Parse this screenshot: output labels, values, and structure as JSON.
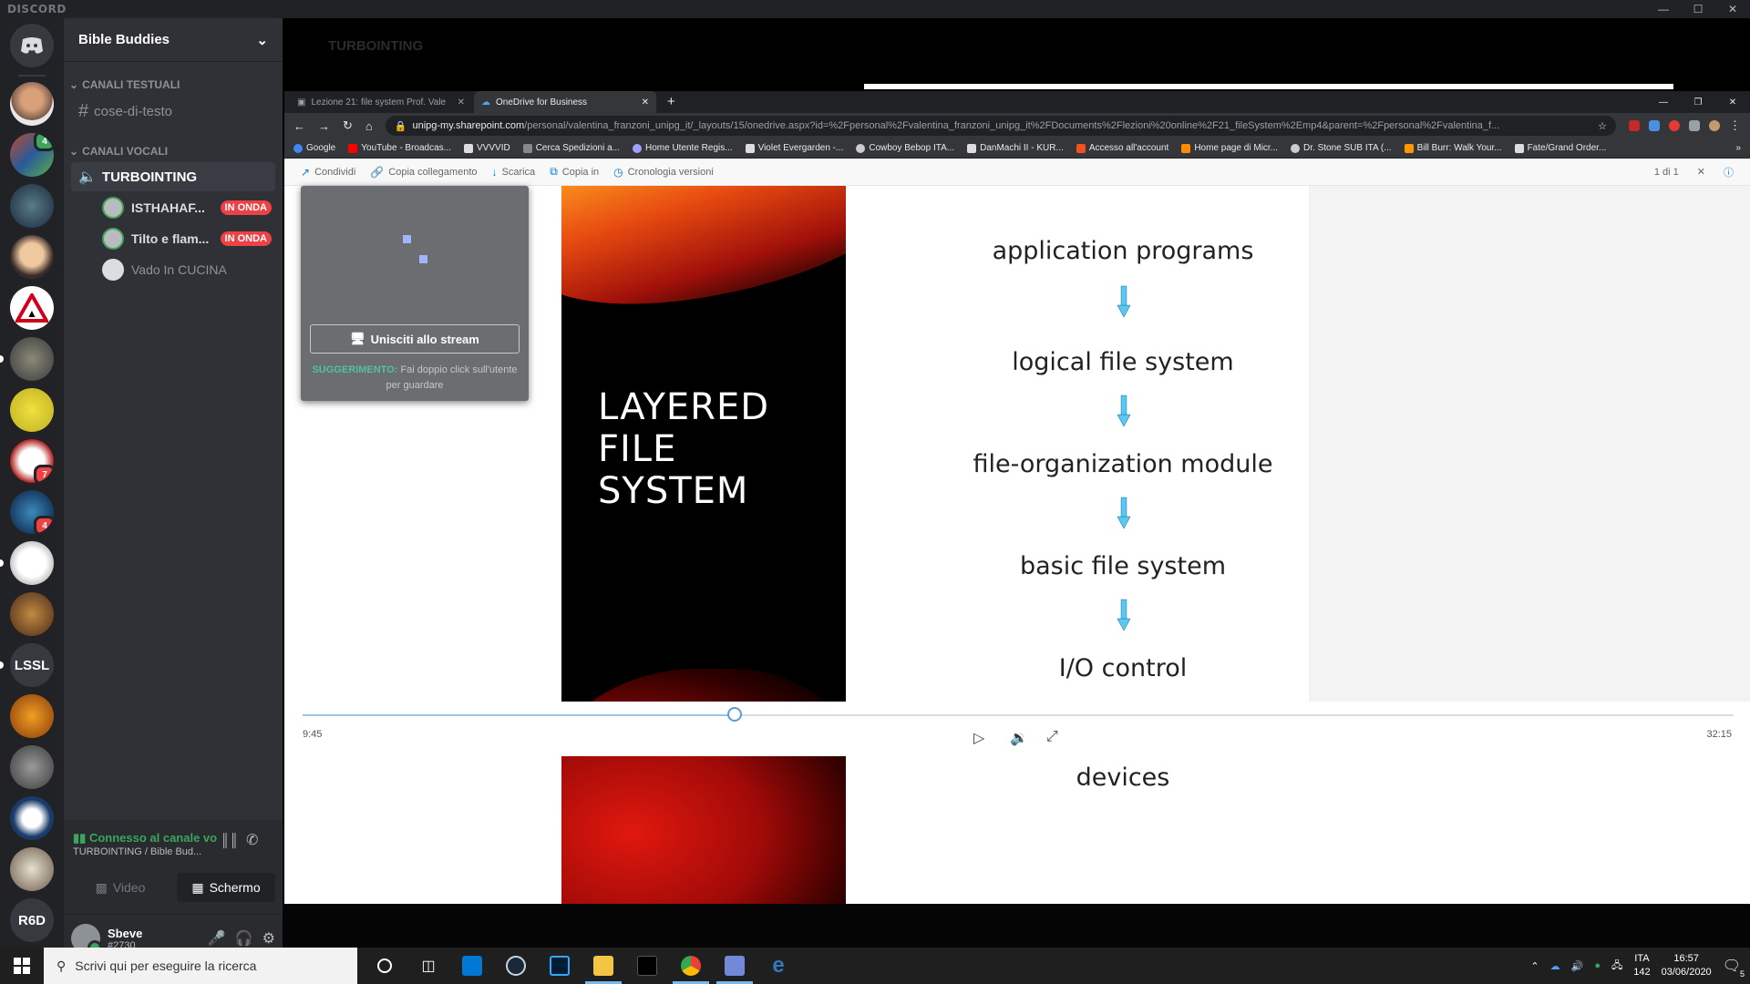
{
  "app": {
    "name": "DISCORD"
  },
  "colors": {
    "accent_green": "#3ba55d",
    "live_red": "#ed4245",
    "bg_dark": "#202225",
    "sidebar": "#2f3136"
  },
  "servers": [
    {
      "icon": "user-avatar",
      "badge": ""
    },
    {
      "icon": "server-avatar",
      "badge": "4"
    },
    {
      "icon": "server-avatar",
      "badge": ""
    },
    {
      "icon": "server-avatar",
      "badge": ""
    },
    {
      "icon": "warning-sign",
      "badge": ""
    },
    {
      "icon": "server-avatar",
      "badge": ""
    },
    {
      "icon": "server-avatar",
      "badge": ""
    },
    {
      "icon": "server-avatar",
      "badge": "7"
    },
    {
      "icon": "server-avatar",
      "badge": "4"
    },
    {
      "icon": "server-avatar",
      "badge": ""
    },
    {
      "icon": "server-avatar",
      "badge": ""
    },
    {
      "text": "LSSL"
    },
    {
      "icon": "server-avatar",
      "badge": ""
    },
    {
      "icon": "server-avatar",
      "badge": ""
    },
    {
      "icon": "server-avatar",
      "badge": ""
    },
    {
      "icon": "server-avatar",
      "badge": ""
    },
    {
      "text": "R6D"
    }
  ],
  "sidebar": {
    "guild_name": "Bible Buddies",
    "text_category": "CANALI TESTUALI",
    "text_channel": "cose-di-testo",
    "voice_category": "CANALI VOCALI",
    "voice_channel": "TURBOINTING",
    "voice_users": [
      {
        "name": "ISTHAHAF...",
        "live": "IN ONDA"
      },
      {
        "name": "Tilto e flam...",
        "live": "IN ONDA"
      },
      {
        "name": "Vado In CUCINA",
        "live": ""
      }
    ],
    "voice_status": {
      "connected": "Connesso al canale vo",
      "location": "TURBOINTING / Bible Bud...",
      "video_label": "Video",
      "screen_label": "Schermo"
    },
    "user": {
      "name": "Sbeve",
      "tag": "#2730"
    }
  },
  "stream": {
    "faded_title": "TURBOINTING",
    "browser": {
      "tabs": [
        {
          "label": "Lezione 21: file system Prof. Vale"
        },
        {
          "label": "OneDrive for Business"
        }
      ],
      "url_host": "unipg-my.sharepoint.com",
      "url_path": "/personal/valentina_franzoni_unipg_it/_layouts/15/onedrive.aspx?id=%2Fpersonal%2Fvalentina_franzoni_unipg_it%2FDocuments%2Flezioni%20online%2F21_fileSystem%2Emp4&parent=%2Fpersonal%2Fvalentina_f...",
      "bookmarks": [
        "Google",
        "YouTube - Broadcas...",
        "VVVVID",
        "Cerca Spedizioni a...",
        "Home Utente Regis...",
        "Violet Evergarden -...",
        "Cowboy Bebop ITA...",
        "DanMachi II - KUR...",
        "Accesso all'account",
        "Home page di Micr...",
        "Dr. Stone SUB ITA (...",
        "Bill Burr: Walk Your...",
        "Fate/Grand Order..."
      ],
      "toolbar": [
        "Condividi",
        "Copia collegamento",
        "Scarica",
        "Copia in",
        "Cronologia versioni"
      ],
      "page_counter": "1 di 1"
    },
    "slide": {
      "title": "LAYERED FILE SYSTEM",
      "layers": [
        "application programs",
        "logical file system",
        "file-organization module",
        "basic file system",
        "I/O control",
        "devices"
      ]
    },
    "player": {
      "current_time": "9:45",
      "duration": "32:15",
      "progress": 0.302
    },
    "overlay": {
      "join_button": "Unisciti allo stream",
      "hint_label": "SUGGERIMENTO:",
      "hint_text": "Fai doppio click sull'utente per guardare"
    }
  },
  "taskbar": {
    "search_placeholder": "Scrivi qui per eseguire la ricerca",
    "lang": "ITA",
    "lang_sub": "142",
    "time": "16:57",
    "date": "03/06/2020",
    "notif_count": "5"
  }
}
